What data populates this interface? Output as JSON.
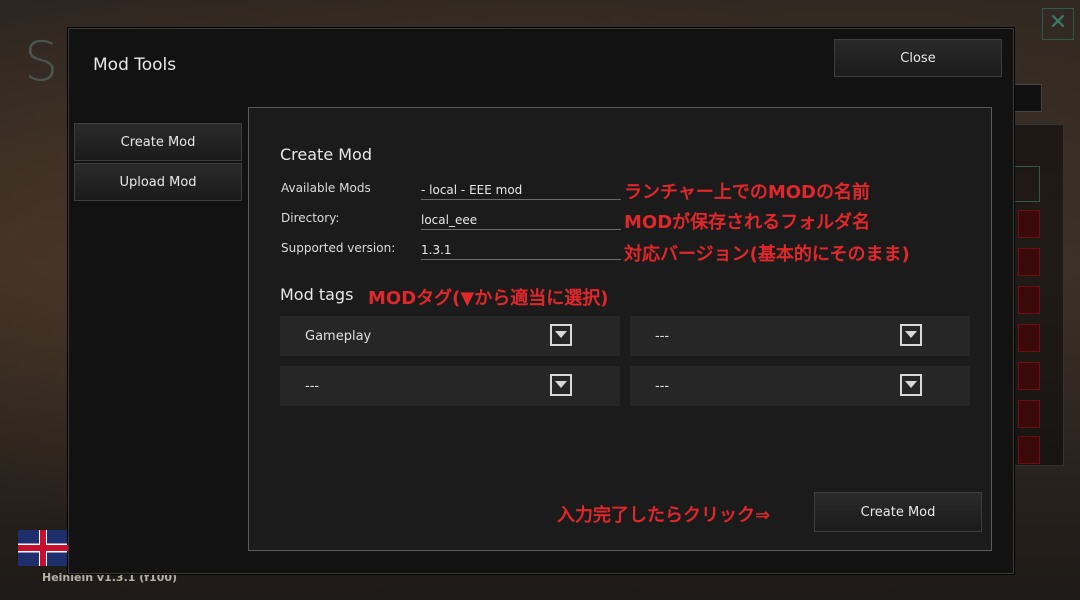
{
  "background": {
    "logo_letter": "S",
    "close_glyph": "✕",
    "version": "Heinlein v1.3.1 (f100)"
  },
  "dialog": {
    "title": "Mod Tools",
    "close_label": "Close",
    "sidebar": {
      "items": [
        {
          "label": "Create Mod"
        },
        {
          "label": "Upload Mod"
        }
      ]
    },
    "panel": {
      "title": "Create Mod",
      "fields": [
        {
          "label": "Available Mods",
          "value": "- local - EEE mod"
        },
        {
          "label": "Directory:",
          "value": "local_eee"
        },
        {
          "label": "Supported version:",
          "value": "1.3.1"
        }
      ],
      "tags_title": "Mod tags",
      "tags": [
        "Gameplay",
        "---",
        "---",
        "---"
      ],
      "create_label": "Create Mod"
    }
  },
  "annotations": {
    "mod_name": "ランチャー上でのMODの名前",
    "folder_name": "MODが保存されるフォルダ名",
    "version": "対応バージョン(基本的にそのまま)",
    "tags": "MODタグ(▼から適当に選択)",
    "click": "入力完了したらクリック⇒"
  },
  "colors": {
    "annotation": "#e0272b",
    "dialog_bg": "#121212",
    "panel_bg": "#1b1b1b",
    "dropdown_bg": "#262626"
  }
}
